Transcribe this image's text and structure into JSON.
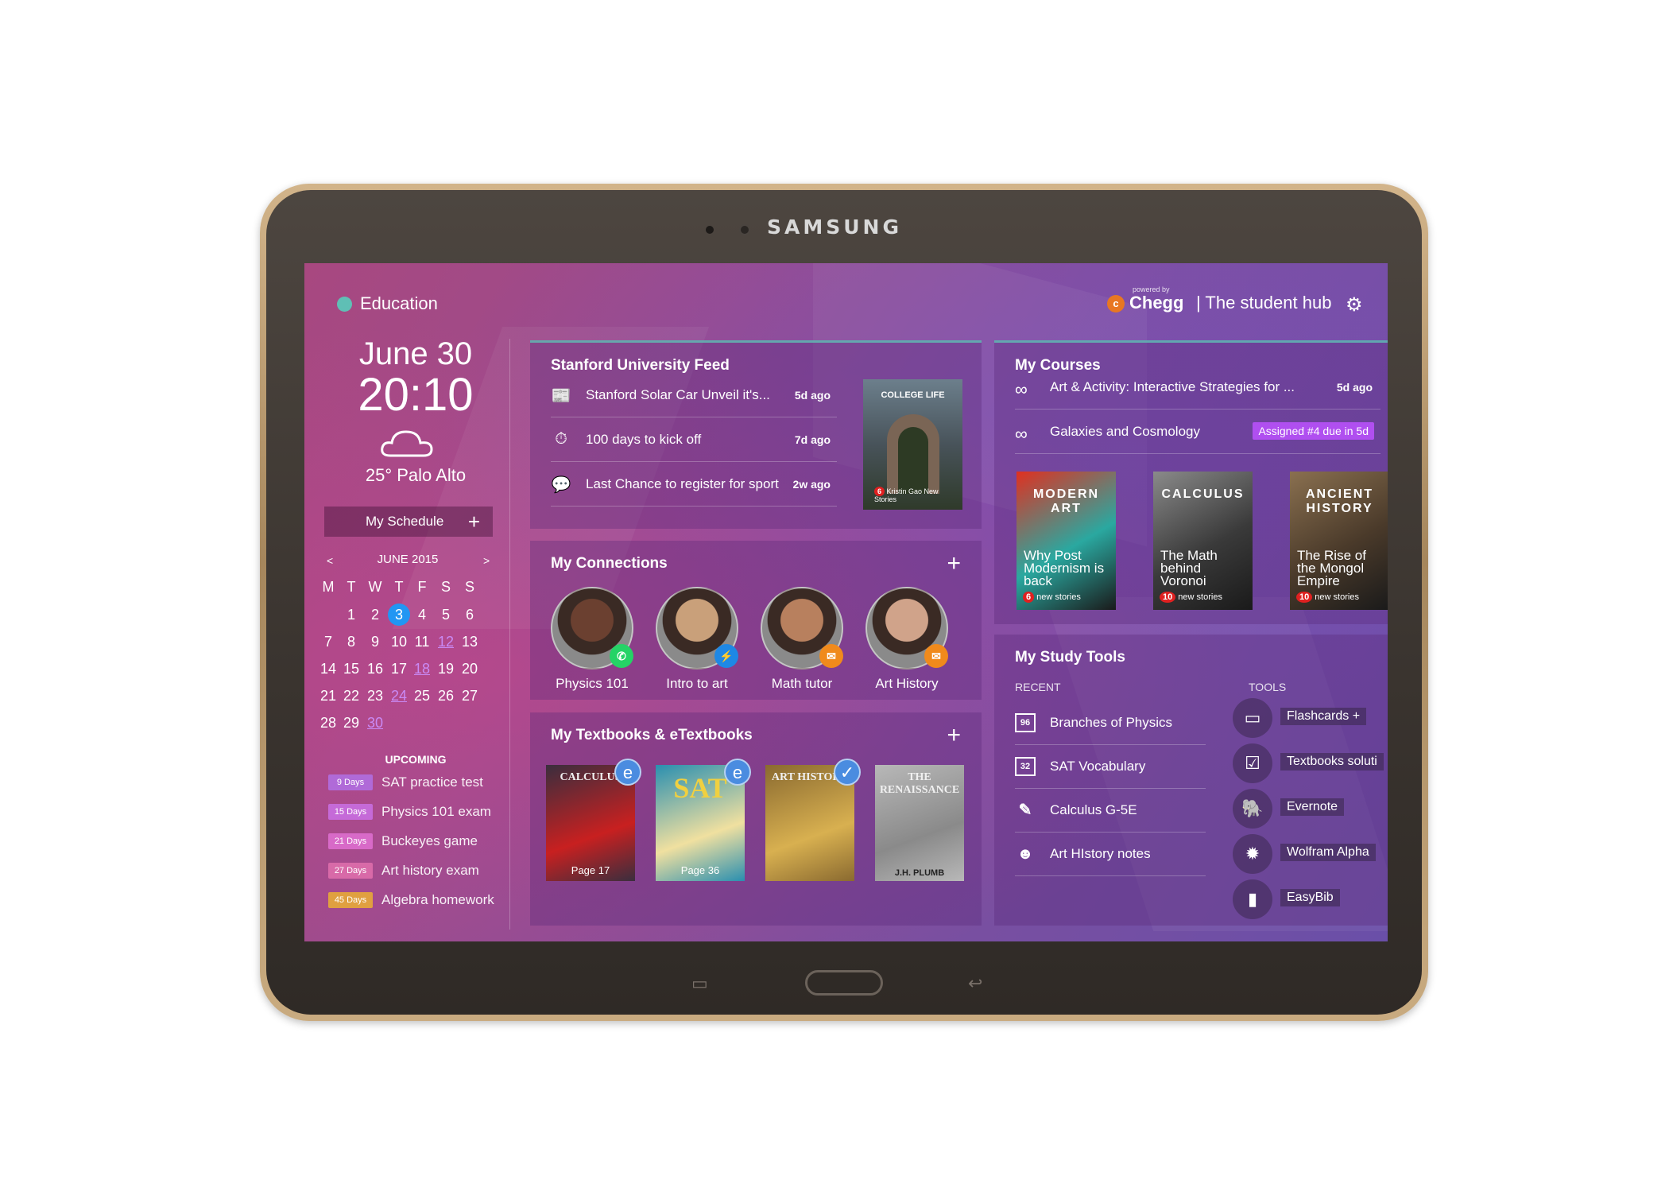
{
  "device": {
    "brand": "SAMSUNG"
  },
  "header": {
    "app_title": "Education",
    "powered_by": "powered by",
    "chegg_logo_letter": "c",
    "chegg_name": "Chegg",
    "tagline": "| The student hub"
  },
  "clock": {
    "date": "June 30",
    "time": "20:10",
    "weather": "25° Palo Alto"
  },
  "schedule": {
    "button_label": "My Schedule",
    "plus": "+"
  },
  "calendar": {
    "prev": "<",
    "next": ">",
    "month": "JUNE 2015",
    "dow": [
      "M",
      "T",
      "W",
      "T",
      "F",
      "S",
      "S"
    ],
    "weeks": [
      [
        "",
        "1",
        "2",
        "3",
        "4",
        "5",
        "6"
      ],
      [
        "7",
        "8",
        "9",
        "10",
        "11",
        "12",
        "13"
      ],
      [
        "14",
        "15",
        "16",
        "17",
        "18",
        "19",
        "20"
      ],
      [
        "21",
        "22",
        "23",
        "24",
        "25",
        "26",
        "27"
      ],
      [
        "28",
        "29",
        "30",
        "",
        "",
        "",
        ""
      ]
    ],
    "today": "3",
    "marked": [
      "12",
      "18",
      "24",
      "30"
    ]
  },
  "upcoming": {
    "heading": "UPCOMING",
    "items": [
      {
        "badge": "9 Days",
        "text": "SAT practice test",
        "color": "#b06ad8"
      },
      {
        "badge": "15 Days",
        "text": "Physics 101 exam",
        "color": "#c56ad8"
      },
      {
        "badge": "21 Days",
        "text": "Buckeyes game",
        "color": "#d86ac8"
      },
      {
        "badge": "27 Days",
        "text": "Art history exam",
        "color": "#d86aa8"
      },
      {
        "badge": "45 Days",
        "text": "Algebra homework",
        "color": "#e0a040"
      }
    ]
  },
  "feed": {
    "title": "Stanford University Feed",
    "items": [
      {
        "icon": "📰",
        "text": "Stanford Solar Car Unveil it's...",
        "age": "5d ago"
      },
      {
        "icon": "⏱",
        "text": "100 days to kick off",
        "age": "7d ago"
      },
      {
        "icon": "💬",
        "text": "Last Chance to register for sport",
        "age": "2w ago"
      }
    ],
    "thumb": {
      "label": "COLLEGE LIFE",
      "count": "6",
      "caption": "Kristin Gao New Stories"
    }
  },
  "connections": {
    "title": "My Connections",
    "plus": "+",
    "people": [
      {
        "name": "Physics 101",
        "badge_icon": "✆",
        "badge_color": "#25d366",
        "skin": "#6b4030"
      },
      {
        "name": "Intro to art",
        "badge_icon": "⚡",
        "badge_color": "#1e88e5",
        "skin": "#c9a07a"
      },
      {
        "name": "Math tutor",
        "badge_icon": "✉",
        "badge_color": "#f08a1c",
        "skin": "#b8805e"
      },
      {
        "name": "Art History",
        "badge_icon": "✉",
        "badge_color": "#f08a1c",
        "skin": "#d0a38a"
      }
    ]
  },
  "textbooks": {
    "title": "My Textbooks & eTextbooks",
    "plus": "+",
    "books": [
      {
        "title": "CALCULUS",
        "page": "Page 17",
        "badge": "e",
        "bg": "#3a2e3e",
        "accent": "#c82020"
      },
      {
        "title": "SAT",
        "page": "Page 36",
        "badge": "e",
        "bg": "#2a8fb0",
        "accent": "#f0e0a0"
      },
      {
        "title": "ART HISTORY",
        "page": "",
        "badge": "✓",
        "bg": "#8a6a30",
        "accent": "#d8b050"
      },
      {
        "title": "THE RENAISSANCE",
        "page": "",
        "badge": "",
        "bg": "#b8b8b8",
        "accent": "#8a8a8a"
      }
    ],
    "book4_author": "J.H. PLUMB"
  },
  "courses": {
    "title": "My Courses",
    "items": [
      {
        "text": "Art & Activity: Interactive Strategies for ...",
        "age": "5d ago",
        "pill": ""
      },
      {
        "text": "Galaxies and Cosmology",
        "age": "",
        "pill": "Assigned #4 due in 5d"
      }
    ],
    "books": [
      {
        "title": "MODERN ART",
        "sub": "Why Post Modernism is back",
        "count": "6",
        "badge_text": "new stories",
        "bg": "#2aa8a0",
        "accent": "#e03020"
      },
      {
        "title": "CALCULUS",
        "sub": "The Math behind Voronoi",
        "count": "10",
        "badge_text": "new stories",
        "bg": "#3a3a3a",
        "accent": "#8a8a8a"
      },
      {
        "title": "ANCIENT HISTORY",
        "sub": "The Rise of the Mongol Empire",
        "count": "10",
        "badge_text": "new stories",
        "bg": "#4a3a2a",
        "accent": "#8a7050"
      }
    ]
  },
  "study_tools": {
    "title": "My Study Tools",
    "recent_heading": "RECENT",
    "tools_heading": "TOOLS",
    "recent": [
      {
        "icon": "96",
        "text": "Branches of Physics"
      },
      {
        "icon": "32",
        "text": "SAT Vocabulary"
      },
      {
        "icon": "✎",
        "text": "Calculus G-5E"
      },
      {
        "icon": "☻",
        "text": "Art HIstory notes"
      }
    ],
    "tools": [
      {
        "icon": "▭",
        "text": "Flashcards +"
      },
      {
        "icon": "☑",
        "text": "Textbooks soluti"
      },
      {
        "icon": "🐘",
        "text": "Evernote"
      },
      {
        "icon": "✹",
        "text": "Wolfram Alpha"
      },
      {
        "icon": "▮",
        "text": "EasyBib"
      }
    ]
  }
}
